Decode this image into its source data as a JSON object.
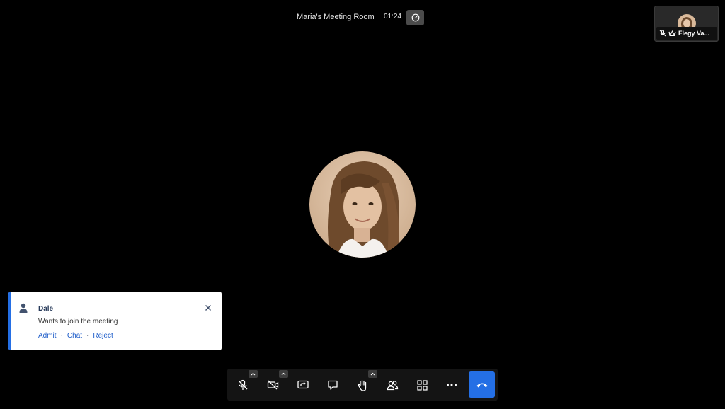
{
  "header": {
    "title": "Maria's Meeting Room",
    "timer": "01:24"
  },
  "thumbnail": {
    "name": "Flegy Va..."
  },
  "notification": {
    "title": "Dale",
    "message": "Wants to join the meeting",
    "actions": {
      "admit": "Admit",
      "chat": "Chat",
      "reject": "Reject",
      "separator": "·"
    }
  },
  "toolbar": {
    "buttons": [
      "microphone-muted",
      "camera-off",
      "screen-share",
      "chat",
      "raise-hand",
      "participants",
      "tile-view",
      "more",
      "hang-up"
    ]
  },
  "colors": {
    "background": "#000000",
    "accent": "#246fe5",
    "toolbar": "#141414"
  }
}
